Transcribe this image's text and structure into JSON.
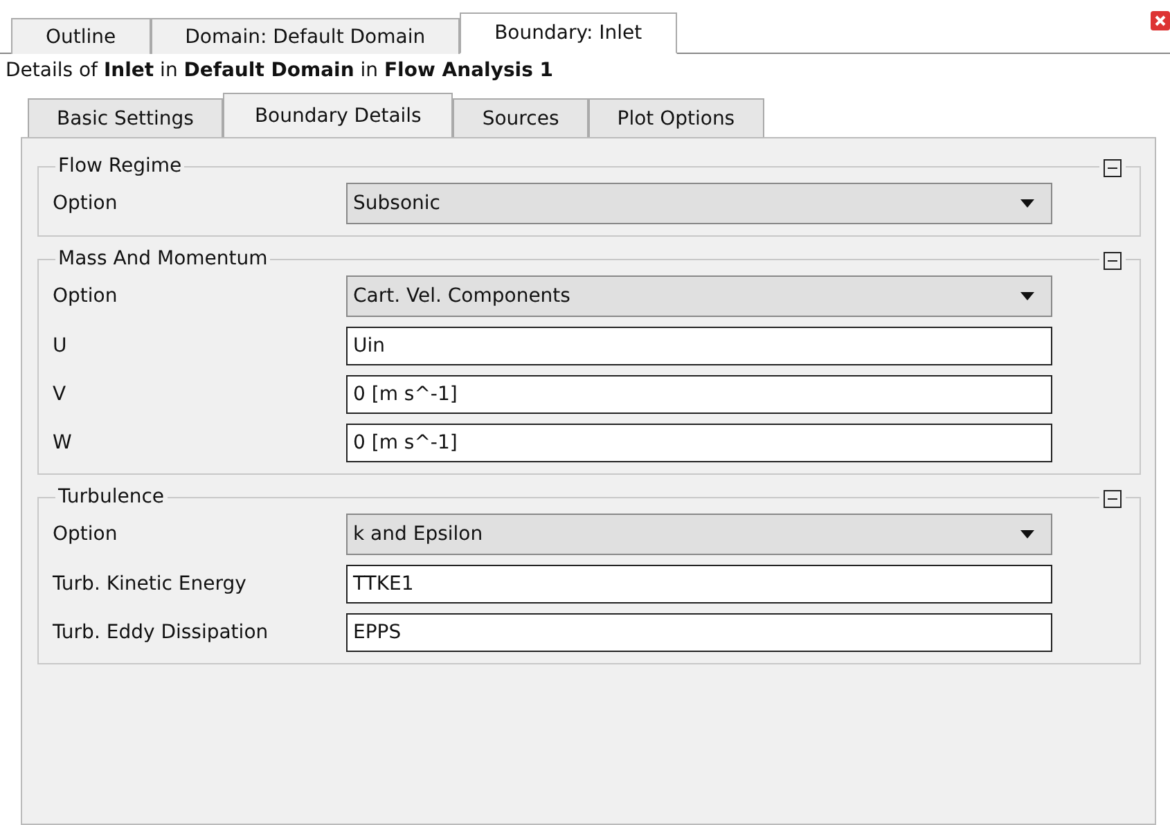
{
  "top_tabs": [
    {
      "label": "Outline",
      "selected": false
    },
    {
      "label": "Domain: Default Domain",
      "selected": false
    },
    {
      "label": "Boundary: Inlet",
      "selected": true
    }
  ],
  "details": "Details of **Inlet** in **Default Domain** in **Flow Analysis 1**",
  "tabs": [
    {
      "label": "Basic Settings",
      "selected": false
    },
    {
      "label": "Boundary Details",
      "selected": true
    },
    {
      "label": "Sources",
      "selected": false
    },
    {
      "label": "Plot Options",
      "selected": false
    }
  ],
  "sections": [
    {
      "title": "Flow Regime",
      "expanded": true,
      "fields": [
        {
          "label": "Option",
          "kind": "dropdown",
          "value": "Subsonic"
        }
      ]
    },
    {
      "title": "Mass And Momentum",
      "expanded": true,
      "fields": [
        {
          "label": "Option",
          "kind": "dropdown",
          "value": "Cart. Vel. Components"
        },
        {
          "label": "U",
          "kind": "text",
          "value": "Uin"
        },
        {
          "label": "V",
          "kind": "text",
          "value": "0 [m s^-1]"
        },
        {
          "label": "W",
          "kind": "text",
          "value": "0 [m s^-1]"
        }
      ]
    },
    {
      "title": "Turbulence",
      "expanded": true,
      "fields": [
        {
          "label": "Option",
          "kind": "dropdown",
          "value": "k and Epsilon"
        },
        {
          "label": "Turb. Kinetic Energy",
          "kind": "text",
          "value": "TTKE1"
        },
        {
          "label": "Turb. Eddy Dissipation",
          "kind": "text",
          "value": "EPPS"
        }
      ]
    }
  ]
}
